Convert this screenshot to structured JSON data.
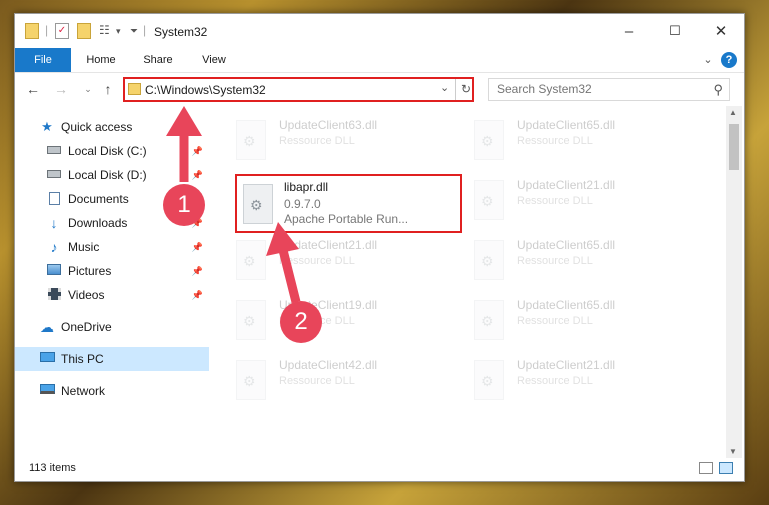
{
  "window": {
    "title": "System32",
    "minimize_glyph": "–",
    "maximize_glyph": "☐",
    "close_glyph": "✕"
  },
  "ribbon": {
    "tabs": [
      "File",
      "Home",
      "Share",
      "View"
    ],
    "expand_glyph": "⌄",
    "help_glyph": "?"
  },
  "address": {
    "path": "C:\\Windows\\System32"
  },
  "search": {
    "placeholder": "Search System32"
  },
  "sidebar": {
    "items": [
      {
        "label": "Quick access",
        "icon": "star-icon",
        "pinned": false
      },
      {
        "label": "Local Disk (C:)",
        "icon": "drive-icon",
        "pinned": true
      },
      {
        "label": "Local Disk (D:)",
        "icon": "drive-icon",
        "pinned": true
      },
      {
        "label": "Documents",
        "icon": "documents-icon",
        "pinned": true
      },
      {
        "label": "Downloads",
        "icon": "download-arrow-icon",
        "pinned": true
      },
      {
        "label": "Music",
        "icon": "music-note-icon",
        "pinned": true
      },
      {
        "label": "Pictures",
        "icon": "pictures-icon",
        "pinned": true
      },
      {
        "label": "Videos",
        "icon": "film-icon",
        "pinned": true
      },
      {
        "label": "OneDrive",
        "icon": "cloud-icon",
        "pinned": false
      },
      {
        "label": "This PC",
        "icon": "monitor-icon",
        "pinned": false,
        "selected": true
      },
      {
        "label": "Network",
        "icon": "network-icon",
        "pinned": false
      }
    ]
  },
  "files": [
    {
      "name": "UpdateClient63.dll",
      "line2": "Ressource DLL",
      "faded": true
    },
    {
      "name": "UpdateClient65.dll",
      "line2": "Ressource DLL",
      "faded": true
    },
    {
      "name": "libapr.dll",
      "line2": "0.9.7.0",
      "line3": "Apache Portable Run...",
      "highlighted": true
    },
    {
      "name": "UpdateClient21.dll",
      "line2": "Ressource DLL",
      "faded": true
    },
    {
      "name": "UpdateClient21.dll",
      "line2": "Ressource DLL",
      "faded": true
    },
    {
      "name": "UpdateClient65.dll",
      "line2": "Ressource DLL",
      "faded": true
    },
    {
      "name": "UpdateClient19.dll",
      "line2": "Ressource DLL",
      "faded": true
    },
    {
      "name": "UpdateClient65.dll",
      "line2": "Ressource DLL",
      "faded": true
    },
    {
      "name": "UpdateClient42.dll",
      "line2": "Ressource DLL",
      "faded": true
    },
    {
      "name": "UpdateClient21.dll",
      "line2": "Ressource DLL",
      "faded": true
    }
  ],
  "status": {
    "item_count": "113 items"
  },
  "annotations": [
    {
      "label": "1"
    },
    {
      "label": "2"
    }
  ],
  "colors": {
    "accent": "#1979ca",
    "highlight_border": "#e02020",
    "annotation_arrow": "#e8455a",
    "selection": "#cce8ff"
  }
}
